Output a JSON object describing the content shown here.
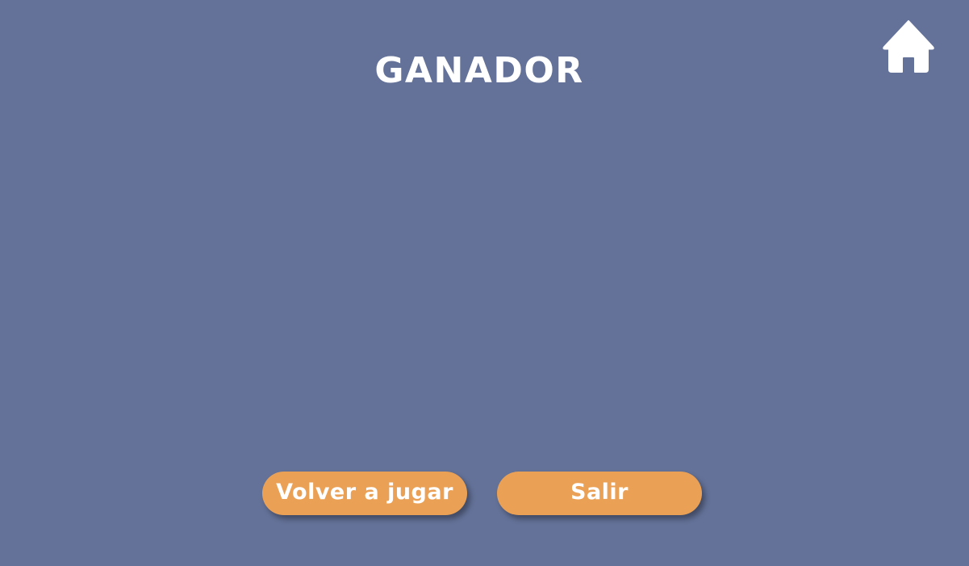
{
  "screen": {
    "title": "GANADOR",
    "background_color": "#647299"
  },
  "header": {
    "home_icon": "home-icon"
  },
  "actions": {
    "replay_label": "Volver a jugar",
    "exit_label": "Salir",
    "button_color": "#eaa155"
  }
}
